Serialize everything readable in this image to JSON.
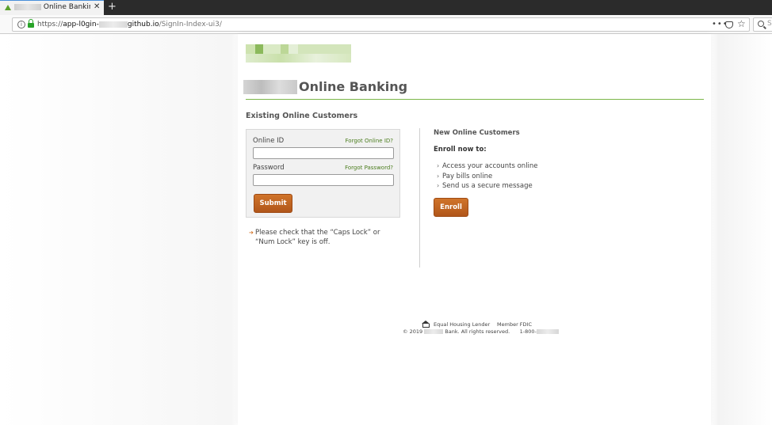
{
  "browser": {
    "tab_title_suffix": "Online Banking",
    "url_scheme": "https://",
    "url_host_prefix": "app-l0gin-",
    "url_host_suffix": "github.io",
    "url_path": "/SignIn-Index-ui3/",
    "search_letter": "S"
  },
  "page": {
    "title": "Online Banking",
    "existing_heading": "Existing Online Customers",
    "login": {
      "online_id_label": "Online ID",
      "forgot_id": "Forgot Online ID?",
      "password_label": "Password",
      "forgot_password": "Forgot Password?",
      "online_id_value": "",
      "password_value": "",
      "submit": "Submit"
    },
    "caps_note": "Please check that the “Caps Lock” or “Num Lock” key is off.",
    "new_customers": {
      "heading": "New Online Customers",
      "lead": "Enroll now to:",
      "benefits": [
        "Access your accounts online",
        "Pay bills online",
        "Send us a secure message"
      ],
      "enroll": "Enroll"
    },
    "footer": {
      "equal_housing": "Equal Housing Lender",
      "fdic": "Member FDIC",
      "copyright_year": "© 2019",
      "rights": "Bank. All rights reserved.",
      "phone_prefix": "1-800-"
    }
  },
  "colors": {
    "accent_green": "#7ab648",
    "button_orange": "#c0621f",
    "link_green": "#4b7d1e"
  }
}
